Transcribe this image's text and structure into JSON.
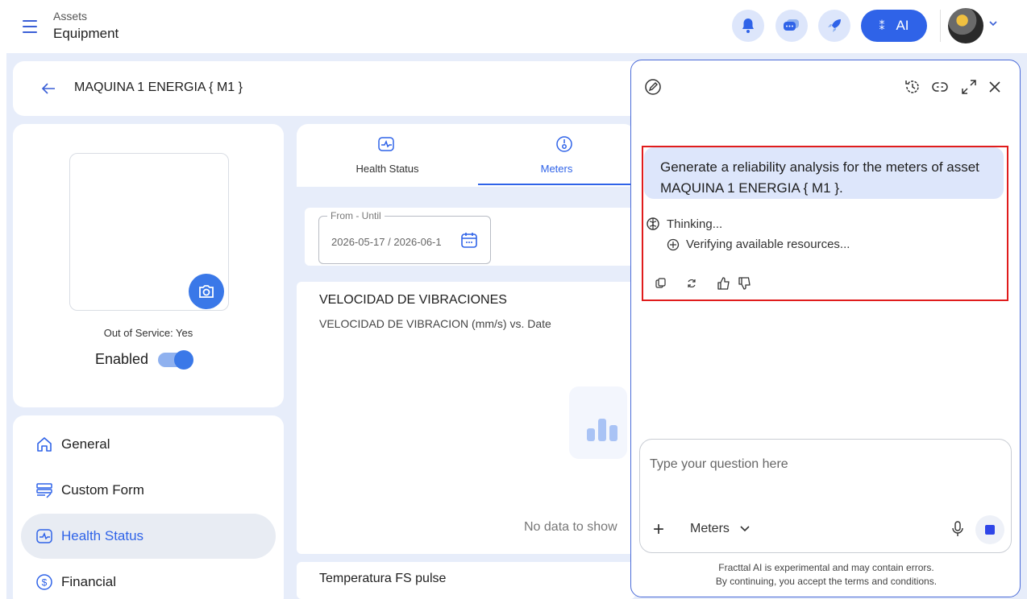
{
  "header": {
    "breadcrumb_parent": "Assets",
    "breadcrumb_current": "Equipment",
    "ai_label": "AI"
  },
  "asset": {
    "title": "MAQUINA 1 ENERGIA { M1 }",
    "out_of_service": "Out of Service: Yes",
    "enabled_label": "Enabled",
    "enabled": true
  },
  "nav": {
    "items": [
      {
        "label": "General",
        "icon": "home-icon"
      },
      {
        "label": "Custom Form",
        "icon": "form-icon"
      },
      {
        "label": "Health Status",
        "icon": "health-icon",
        "active": true
      },
      {
        "label": "Financial",
        "icon": "dollar-icon"
      }
    ]
  },
  "tabs": [
    {
      "label": "Health Status",
      "icon": "health-icon"
    },
    {
      "label": "Meters",
      "icon": "gauge-icon",
      "active": true
    }
  ],
  "filter": {
    "legend": "From - Until",
    "value": "2026-05-17 / 2026-06-1"
  },
  "chart": {
    "title": "VELOCIDAD DE VIBRACIONES",
    "subtitle": "VELOCIDAD DE VIBRACION (mm/s) vs. Date",
    "empty_text": "No data to show"
  },
  "chart2": {
    "title": "Temperatura FS pulse"
  },
  "ai_panel": {
    "user_message": "Generate a reliability analysis for the meters of asset MAQUINA 1 ENERGIA { M1 }.",
    "thinking": "Thinking...",
    "step": "Verifying available resources...",
    "input_placeholder": "Type your question here",
    "context_select": "Meters",
    "disclaimer_1": "Fracttal AI is experimental and may contain errors.",
    "disclaimer_2": "By continuing, you accept the terms and conditions.",
    "highlight_color": "#e01c1c"
  },
  "colors": {
    "accent": "#2f63e8",
    "background": "#e7edfa"
  }
}
